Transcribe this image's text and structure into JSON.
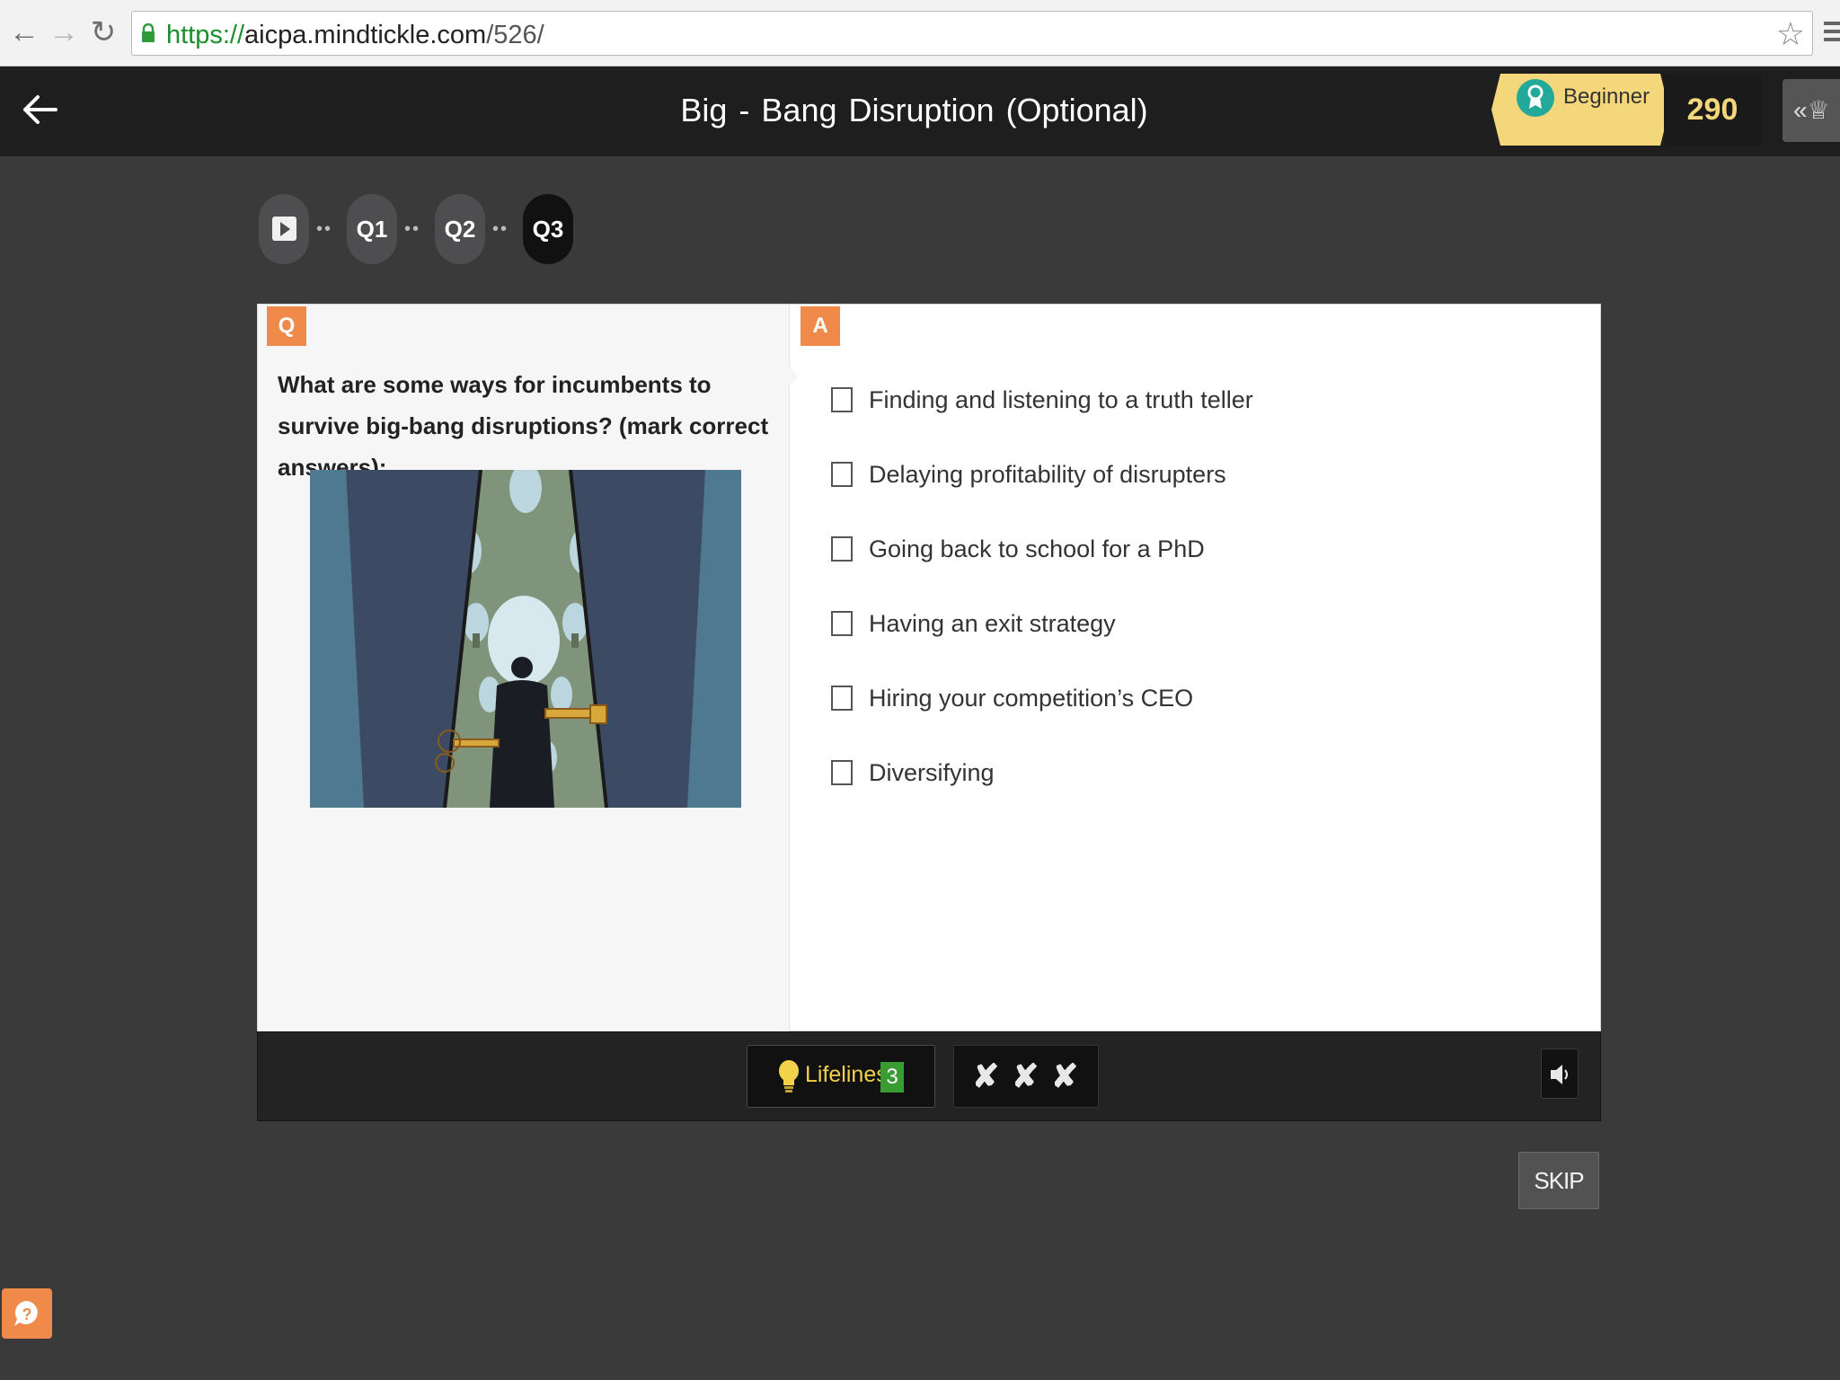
{
  "browser": {
    "url_scheme": "https://",
    "url_host": "aicpa.mindtickle.com",
    "url_path": "/526/"
  },
  "header": {
    "title_words": [
      "Big",
      "-",
      "Bang",
      "Disruption",
      "(Optional)"
    ],
    "level_label": "Beginner",
    "points": "290"
  },
  "progress": {
    "steps": [
      "Q1",
      "Q2",
      "Q3"
    ],
    "current": "Q3"
  },
  "question": {
    "tag": "Q",
    "text": "What are some ways for incumbents to survive big-bang disruptions? (mark correct answers):"
  },
  "answers": {
    "tag": "A",
    "options": [
      {
        "label": "Finding and listening to a truth teller",
        "checked": false
      },
      {
        "label": "Delaying profitability of disrupters",
        "checked": false
      },
      {
        "label": "Going back to school for a PhD",
        "checked": false
      },
      {
        "label": "Having an exit strategy",
        "checked": false
      },
      {
        "label": "Hiring your competition’s CEO",
        "checked": false
      },
      {
        "label": "Diversifying",
        "checked": false
      }
    ]
  },
  "toolbar": {
    "lifelines_label": "Lifelines",
    "lifelines_count": "3",
    "attempts": [
      "✘",
      "✘",
      "✘"
    ]
  },
  "actions": {
    "skip_label": "SKIP"
  },
  "colors": {
    "accent_orange": "#f08a4b",
    "level_badge": "#f4d77a",
    "lifelines_yellow": "#f2d24a",
    "lifelines_count_green": "#3a9b33"
  }
}
